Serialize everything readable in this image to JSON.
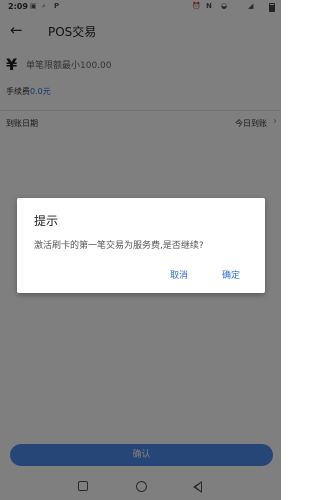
{
  "status_bar": {
    "time": "2:09",
    "icons": [
      "notification-icon",
      "search-icon",
      "p-icon",
      "alarm-icon",
      "nfc-icon",
      "wifi-icon",
      "signal-icon",
      "battery-icon"
    ]
  },
  "appbar": {
    "back_icon": "←",
    "title": "POS交易"
  },
  "amount": {
    "currency_symbol": "¥",
    "placeholder": "单笔限额最小100.00"
  },
  "fee": {
    "label": "手续费",
    "value": "0.0元"
  },
  "arrival": {
    "label": "到账日期",
    "value": "今日到账",
    "chevron": "›"
  },
  "confirm_button": {
    "label": "确认"
  },
  "dialog": {
    "title": "提示",
    "message": "激活刷卡的第一笔交易为服务费,是否继续?",
    "cancel_label": "取消",
    "ok_label": "确定"
  },
  "colors": {
    "accent": "#2a6fd6",
    "button": "#4f8df0",
    "scrim": "rgba(0,0,0,0.5)"
  }
}
